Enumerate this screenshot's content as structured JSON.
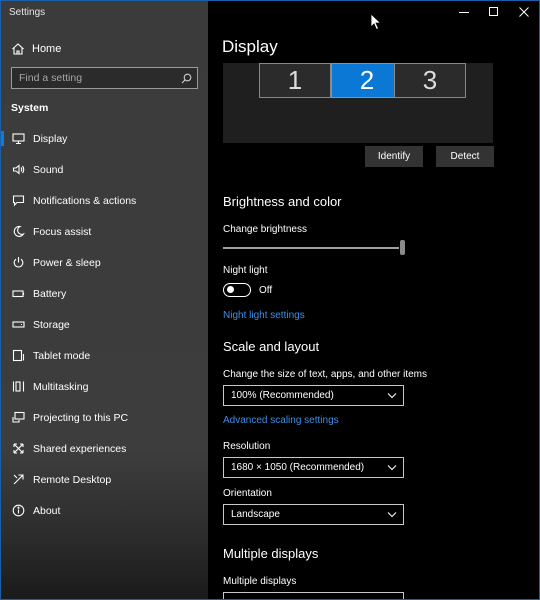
{
  "window": {
    "app_title": "Settings",
    "accent": "#0a78d4",
    "link_color": "#3d8fe8"
  },
  "sidebar": {
    "home": {
      "label": "Home",
      "icon": "home-icon"
    },
    "search": {
      "placeholder": "Find a setting",
      "icon": "search-icon"
    },
    "section": "System",
    "items": [
      {
        "label": "Display",
        "icon": "monitor-icon",
        "active": true
      },
      {
        "label": "Sound",
        "icon": "speaker-icon"
      },
      {
        "label": "Notifications & actions",
        "icon": "message-icon"
      },
      {
        "label": "Focus assist",
        "icon": "moon-icon"
      },
      {
        "label": "Power & sleep",
        "icon": "power-icon"
      },
      {
        "label": "Battery",
        "icon": "battery-icon"
      },
      {
        "label": "Storage",
        "icon": "storage-icon"
      },
      {
        "label": "Tablet mode",
        "icon": "tablet-icon"
      },
      {
        "label": "Multitasking",
        "icon": "multitasking-icon"
      },
      {
        "label": "Projecting to this PC",
        "icon": "projector-icon"
      },
      {
        "label": "Shared experiences",
        "icon": "share-icon"
      },
      {
        "label": "Remote Desktop",
        "icon": "remote-icon"
      },
      {
        "label": "About",
        "icon": "info-icon"
      }
    ]
  },
  "main": {
    "title": "Display",
    "monitors": [
      {
        "label": "1",
        "selected": false
      },
      {
        "label": "2",
        "selected": true
      },
      {
        "label": "3",
        "selected": false
      }
    ],
    "identify_label": "Identify",
    "detect_label": "Detect",
    "brightness": {
      "heading": "Brightness and color",
      "label": "Change brightness",
      "value_percent": 100
    },
    "night_light": {
      "label": "Night light",
      "state": "Off",
      "settings_link": "Night light settings"
    },
    "scale": {
      "heading": "Scale and layout",
      "label": "Change the size of text, apps, and other items",
      "value": "100% (Recommended)",
      "advanced_link": "Advanced scaling settings"
    },
    "resolution": {
      "label": "Resolution",
      "value": "1680 × 1050 (Recommended)"
    },
    "orientation": {
      "label": "Orientation",
      "value": "Landscape"
    },
    "multiple": {
      "heading": "Multiple displays",
      "label": "Multiple displays"
    }
  }
}
